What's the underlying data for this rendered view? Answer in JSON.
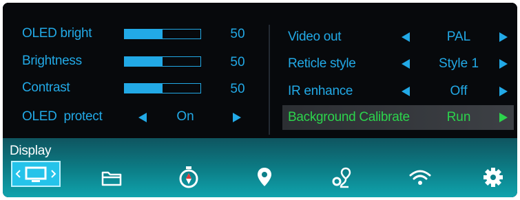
{
  "left_settings": [
    {
      "label": "OLED bright",
      "type": "slider",
      "value": "50",
      "level": 0.5
    },
    {
      "label": "Brightness",
      "type": "slider",
      "value": "50",
      "level": 0.5
    },
    {
      "label": "Contrast",
      "type": "slider",
      "value": "50",
      "level": 0.5
    },
    {
      "label": "OLED  protect",
      "type": "select",
      "value": "On"
    }
  ],
  "right_settings": [
    {
      "label": "Video out",
      "type": "select",
      "value": "PAL"
    },
    {
      "label": "Reticle style",
      "type": "select",
      "value": "Style 1"
    },
    {
      "label": "IR enhance",
      "type": "select",
      "value": "Off"
    },
    {
      "label": "Background Calibrate",
      "type": "action",
      "value": "Run",
      "selected": true
    }
  ],
  "bottom_nav": {
    "active_tab_label": "Display",
    "icons": [
      "display-icon",
      "folder-icon",
      "compass-icon",
      "location-pin-icon",
      "route-icon",
      "wifi-icon",
      "gear-icon"
    ]
  },
  "colors": {
    "accent": "#22a9e6",
    "selected": "#2cd44c",
    "panel": "#07090c",
    "nav_bar": "#0c7f88",
    "active_tab": "#25c3ea"
  }
}
